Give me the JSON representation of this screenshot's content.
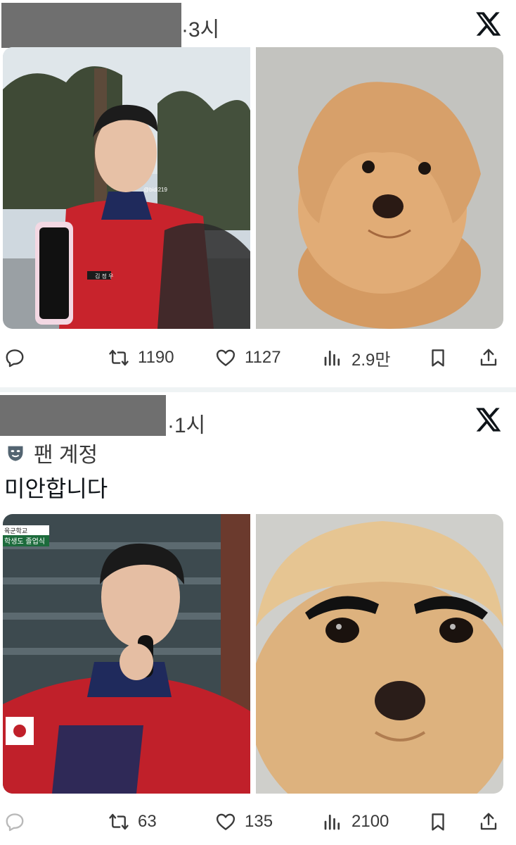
{
  "posts": [
    {
      "time": "·3시",
      "text": "",
      "metrics": {
        "retweets": "1190",
        "likes": "1127",
        "views": "2.9만"
      }
    },
    {
      "time": "·1시",
      "fan_label": "팬 계정",
      "text": "미안합니다",
      "metrics": {
        "retweets": "63",
        "likes": "135",
        "views": "2100"
      }
    }
  ],
  "icons": [
    "x-logo-icon",
    "reply-icon",
    "retweet-icon",
    "heart-icon",
    "views-icon",
    "bookmark-icon",
    "share-icon",
    "mask-icon"
  ],
  "images": {
    "post1_left_watermark": "@bidi219",
    "post1_left_nametag": "김 정 우",
    "post2_left_broadcast_top": "육군학교",
    "post2_left_broadcast_bottom": "학생도 졸업식"
  },
  "colors": {
    "accent": "#0f1419",
    "muted": "#536471",
    "separator": "#eff3f4"
  }
}
